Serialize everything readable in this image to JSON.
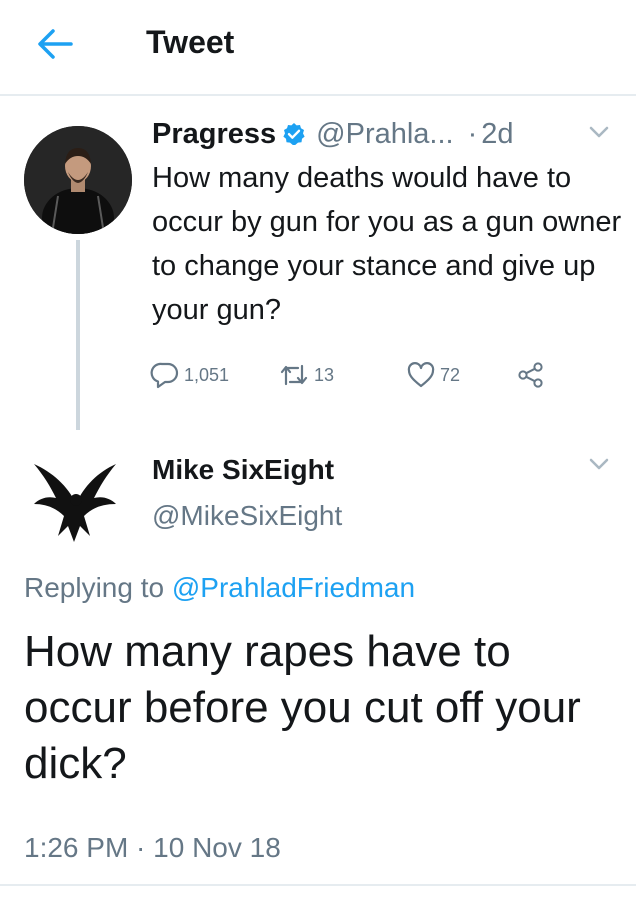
{
  "header": {
    "title": "Tweet",
    "back_icon": "arrow-left-icon"
  },
  "colors": {
    "accent": "#1da1f2",
    "text": "#14171a",
    "secondary": "#657786",
    "divider": "#e6ecf0",
    "thread_line": "#ccd6dd"
  },
  "original_tweet": {
    "author_name": "Pragress",
    "verified": true,
    "handle": "@Prahla...",
    "separator": "·",
    "time": "2d",
    "text": "How many deaths would have to occur by gun for you as a gun owner to change your stance and give up your gun?",
    "reply_count": "1,051",
    "retweet_count": "13",
    "like_count": "72",
    "icons": [
      "reply-icon",
      "retweet-icon",
      "like-icon",
      "share-icon",
      "chevron-down-icon",
      "verified-badge-icon"
    ]
  },
  "reply_tweet": {
    "author_name": "Mike SixEight",
    "handle": "@MikeSixEight",
    "replying_prefix": "Replying to",
    "replying_to": "@PrahladFriedman",
    "text": "How many rapes have to occur before you cut off your dick?",
    "timestamp": "1:26 PM · 10 Nov 18"
  }
}
